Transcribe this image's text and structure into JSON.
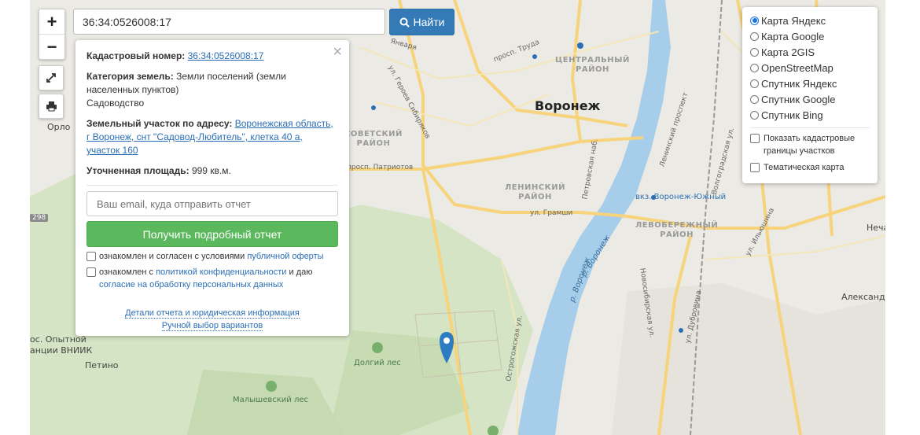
{
  "search": {
    "value": "36:34:0526008:17",
    "button_label": "Найти"
  },
  "zoom": {
    "in_label": "+",
    "out_label": "−"
  },
  "info_panel": {
    "close_label": "×",
    "cadastral_label": "Кадастровый номер:",
    "cadastral_value": "36:34:0526008:17",
    "category_label": "Категория земель:",
    "category_value": "Земли поселений (земли населенных пунктов)",
    "usage_value": "Садоводство",
    "address_label": "Земельный участок по адресу:",
    "address_value": "Воронежская область, г Воронеж, снт \"Садовод-Любитель\", клетка 40 а, участок 160",
    "area_label": "Уточненная площадь:",
    "area_value": "999 кв.м.",
    "email_placeholder": "Ваш email, куда отправить отчет",
    "report_button": "Получить подробный отчет",
    "consent1_prefix": "ознакомлен и согласен с условиями",
    "consent1_link": "публичной оферты",
    "consent2_prefix": "ознакомлен с",
    "consent2_link1": "политикой конфиденциальности",
    "consent2_mid": "и даю",
    "consent2_link2": "согласие на обработку персональных данных",
    "details_link": "Детали отчета и юридическая информация",
    "manual_link": "Ручной выбор вариантов"
  },
  "layers": {
    "options": [
      "Карта Яндекс",
      "Карта Google",
      "Карта 2GIS",
      "OpenStreetMap",
      "Спутник Яндекс",
      "Спутник Google",
      "Спутник Bing"
    ],
    "selected": "Карта Яндекс",
    "cadastral_borders": "Показать кадастровые границы участков",
    "thematic": "Тематическая карта"
  },
  "map_labels": {
    "city": "Воронеж",
    "central": "ЦЕНТРАЛЬНЫЙ\nРАЙОН",
    "soviet": "СОВЕТСКИЙ\nРАЙОН",
    "leninsky": "ЛЕНИНСКИЙ\nРАЙОН",
    "levober": "ЛЕВОБЕРЕЖНЫЙ\nРАЙОН",
    "orlovo": "Орло",
    "petino": "Петино",
    "opytnoy": "ос. Опытной\nанции ВНИИК",
    "alexandrovka": "Александр",
    "necha": "Неча",
    "dolgiy": "Долгий лес",
    "malyshev": "Малышевский лес",
    "river1": "р. Воронеж",
    "river2": "р. Воронеж",
    "patriotov": "просп. Патриотов",
    "gramshi": "ул. Грамши",
    "sibiryakov": "ул. Героев Сибиряков",
    "trud": "просп. Труда",
    "yanvarya": "Января",
    "ostrogozh": "Острогожская ул.",
    "novosib": "Новосибирская ул.",
    "dubrovina": "ул. Дубровина",
    "ilyushina": "ул. Ильюшина",
    "petrovsk": "Петровская наб.",
    "leninsky_pr": "Ленинский проспект",
    "volgogr": "Волгоградская ул.",
    "station": "вкз. Воронеж-Южный",
    "road298": "298"
  },
  "colors": {
    "water": "#a6cdea",
    "road": "#f7d37c",
    "forest": "#cfe1bd",
    "accent": "#337ab7",
    "green_button": "#5cb85c"
  }
}
